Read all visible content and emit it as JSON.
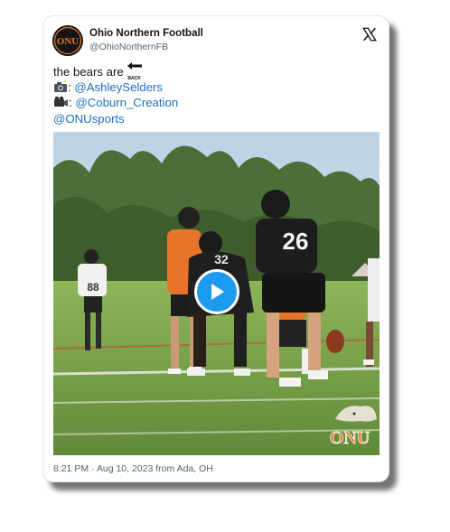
{
  "tweet": {
    "author_name": "Ohio Northern Football",
    "author_handle": "@OhioNorthernFB",
    "text_lead": "the bears are",
    "back_label": "BACK",
    "colon1": ": ",
    "colon2": ": ",
    "mention_photo": "@AshleySelders",
    "mention_video": "@Coburn_Creation",
    "mention_org": "@ONUsports",
    "timestamp": "8:21 PM · Aug 10, 2023 from Ada, OH"
  },
  "media": {
    "jersey_left": "88",
    "jersey_center": "32",
    "jersey_right": "26",
    "watermark": "ONU"
  },
  "icons": {
    "close": "x-logo-icon",
    "back_arrow": "back-arrow-icon",
    "camera": "camera-flash-icon",
    "video": "video-camera-icon",
    "play": "play-icon"
  },
  "colors": {
    "link": "#1d6fbd",
    "play_button": "#1d9bf0",
    "brand_orange": "#e8742a"
  }
}
